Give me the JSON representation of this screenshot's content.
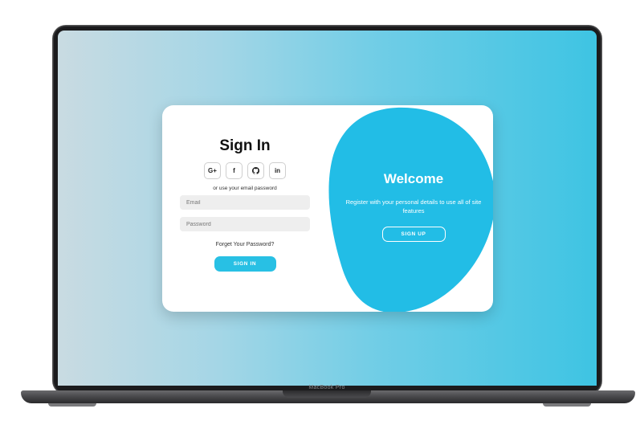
{
  "device": {
    "label": "MacBook Pro"
  },
  "signin": {
    "title": "Sign In",
    "socials": [
      {
        "label": "G+",
        "icon": "google-plus-icon"
      },
      {
        "label": "f",
        "icon": "facebook-icon"
      },
      {
        "label": "",
        "icon": "github-icon"
      },
      {
        "label": "in",
        "icon": "linkedin-icon"
      }
    ],
    "hint": "or use your email password",
    "email_placeholder": "Email",
    "password_placeholder": "Password",
    "forgot": "Forget Your Password?",
    "button": "SIGN IN"
  },
  "welcome": {
    "title": "Welcome",
    "text": "Register with your personal details to use all of site features",
    "button": "SIGN UP"
  },
  "colors": {
    "accent": "#28c0e4",
    "blob": "#22bde6"
  }
}
